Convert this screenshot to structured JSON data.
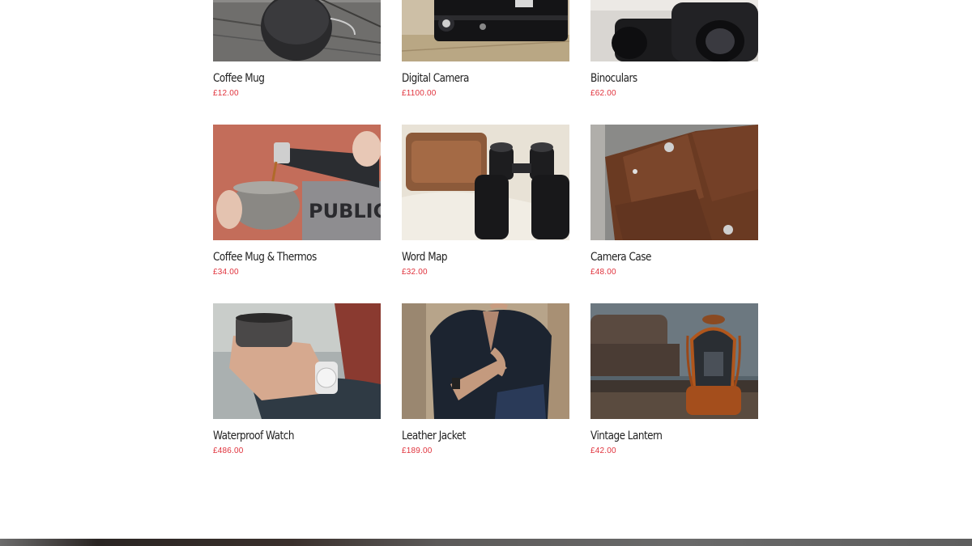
{
  "products": [
    {
      "name": "Coffee Mug",
      "price": "£12.00",
      "image_icon": "coffee-mug-photo"
    },
    {
      "name": "Digital Camera",
      "price": "£1100.00",
      "image_icon": "camera-photo"
    },
    {
      "name": "Binoculars",
      "price": "£62.00",
      "image_icon": "binoculars-photo"
    },
    {
      "name": "Coffee Mug & Thermos",
      "price": "£34.00",
      "image_icon": "thermos-photo"
    },
    {
      "name": "Word Map",
      "price": "£32.00",
      "image_icon": "binoculars-on-map-photo"
    },
    {
      "name": "Camera Case",
      "price": "£48.00",
      "image_icon": "leather-case-photo"
    },
    {
      "name": "Waterproof Watch",
      "price": "£486.00",
      "image_icon": "watch-photo"
    },
    {
      "name": "Leather Jacket",
      "price": "£189.00",
      "image_icon": "jacket-photo"
    },
    {
      "name": "Vintage Lantern",
      "price": "£42.00",
      "image_icon": "lantern-photo"
    }
  ],
  "colors": {
    "price": "#e0323c",
    "title": "#222222",
    "background": "#ffffff"
  }
}
